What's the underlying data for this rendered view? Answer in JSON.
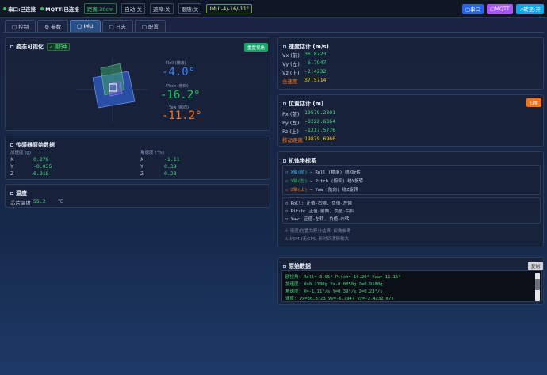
{
  "topbar": {
    "serial": "串口:已连接",
    "mqtt": "MQTT:已连接",
    "distance": "距离:30cm",
    "auto": "自动:关",
    "avoid": "避障:关",
    "follow": "跟随:关",
    "imu": "IMU:-4/-16/-11°",
    "btn_serial": "▢串口",
    "btn_mqtt": "▢MQTT",
    "btn_switch": "↗转至:开"
  },
  "colors": {
    "green": "#22c55e",
    "blue_btn": "#2563eb",
    "purple_btn": "#a855f7",
    "teal_btn": "#0ea5e9",
    "orange": "#f97316",
    "yellow": "#facc15",
    "cyan": "#38bdf8",
    "red": "#f87171"
  },
  "tabs": [
    {
      "label": "▢ 控制"
    },
    {
      "label": "⚙ 参数"
    },
    {
      "label": "▢ IMU"
    },
    {
      "label": "▢ 日志"
    },
    {
      "label": "▢ 配置"
    }
  ],
  "attitude": {
    "title": "姿态可视化",
    "status": "✓ 运行中",
    "reset_button": "重置视角",
    "roll_label": "Roll (横滚)",
    "roll_value": "-4.0°",
    "pitch_label": "Pitch (俯仰)",
    "pitch_value": "-16.2°",
    "yaw_label": "Yaw (航向)",
    "yaw_value": "-11.2°"
  },
  "sensor": {
    "title": "传感器原始数据",
    "accel_head": "加速度 (g)",
    "gyro_head": "角速度 (°/s)",
    "accel": [
      {
        "axis": "X",
        "value": "0.278"
      },
      {
        "axis": "Y",
        "value": "-0.035"
      },
      {
        "axis": "Z",
        "value": "0.918"
      }
    ],
    "gyro": [
      {
        "axis": "X",
        "value": "-1.11"
      },
      {
        "axis": "Y",
        "value": "0.39"
      },
      {
        "axis": "Z",
        "value": "0.23"
      }
    ]
  },
  "temperature": {
    "title": "温度",
    "label": "芯片温度",
    "value": "55.2",
    "unit": "℃"
  },
  "velocity": {
    "title": "速度估计 (m/s)",
    "rows": [
      {
        "label": "Vx (前)",
        "value": "36.8723"
      },
      {
        "label": "Vy (左)",
        "value": "-6.7947"
      },
      {
        "label": "Vz (上)",
        "value": "-2.4232"
      }
    ],
    "total_label": "合速度",
    "total_value": "37.5714"
  },
  "position": {
    "title": "位置估计 (m)",
    "reset_button": "归零",
    "rows": [
      {
        "label": "Px (前)",
        "value": "19579.2301"
      },
      {
        "label": "Py (左)",
        "value": "-3222.6364"
      },
      {
        "label": "Pz (上)",
        "value": "-1217.5776"
      }
    ],
    "total_label": "移动距离",
    "total_value": "19879.6960"
  },
  "frame": {
    "title": "机体坐标系",
    "axes": [
      {
        "axis": "X轴(前)",
        "desc": " — Roll (横滚) 绕X旋转"
      },
      {
        "axis": "Y轴(左)",
        "desc": " — Pitch (俯仰) 绕Y旋转"
      },
      {
        "axis": "Z轴(上)",
        "desc": " — Yaw (航向) 绕Z旋转"
      }
    ],
    "signs": [
      "Roll: 正值-右倾, 负值-左倾",
      "Pitch: 正值-前倾, 负值-后仰",
      "Yaw: 正值-左转, 负值-右转"
    ],
    "notes": [
      "⚠ 速度/位置为积分估算, 仅做参考",
      "⚠ 纯IMU无GPS, 长时间漂移较大"
    ]
  },
  "raw": {
    "title": "原始数据",
    "copy_button": "复制",
    "lines": [
      "欧拉角: Roll=-3.95° Pitch=-16.20° Yaw=-11.15°",
      "加速度: X=0.2780g Y=-0.0350g Z=0.9180g",
      "角速度: X=-1.11°/s Y=0.39°/s Z=0.23°/s",
      "速度:   Vx=36.8723 Vy=-6.7947 Vz=-2.4232 m/s"
    ]
  }
}
